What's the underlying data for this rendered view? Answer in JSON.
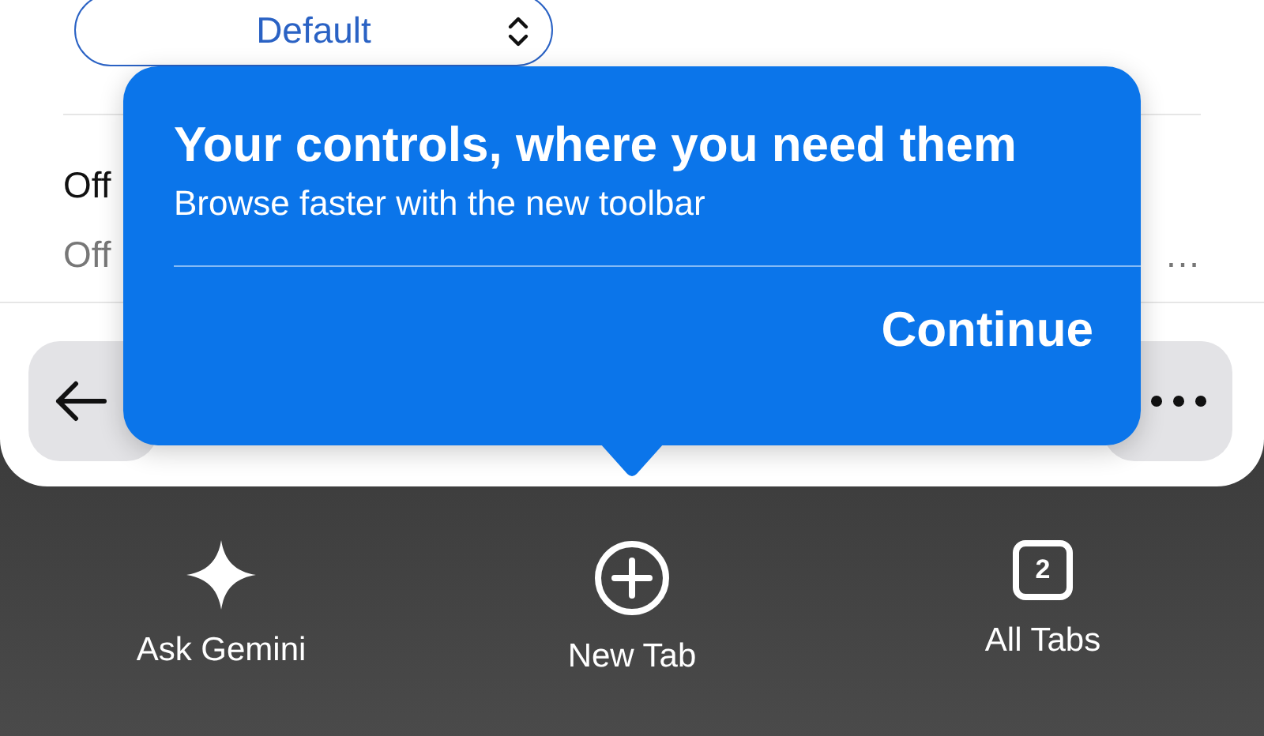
{
  "settings": {
    "select": {
      "value": "Default"
    },
    "rows": [
      {
        "kind": "title",
        "text": "Off"
      },
      {
        "kind": "subtitle",
        "text": "Off",
        "trailing": "…"
      }
    ]
  },
  "popover": {
    "title": "Your controls, where you need them",
    "subtitle": "Browse faster with the new toolbar",
    "action": "Continue"
  },
  "bottom_bar": {
    "items": [
      {
        "kind": "sparkle",
        "label": "Ask Gemini"
      },
      {
        "kind": "plus",
        "label": "New Tab"
      },
      {
        "kind": "tabs",
        "label": "All Tabs",
        "count": "2"
      }
    ]
  }
}
